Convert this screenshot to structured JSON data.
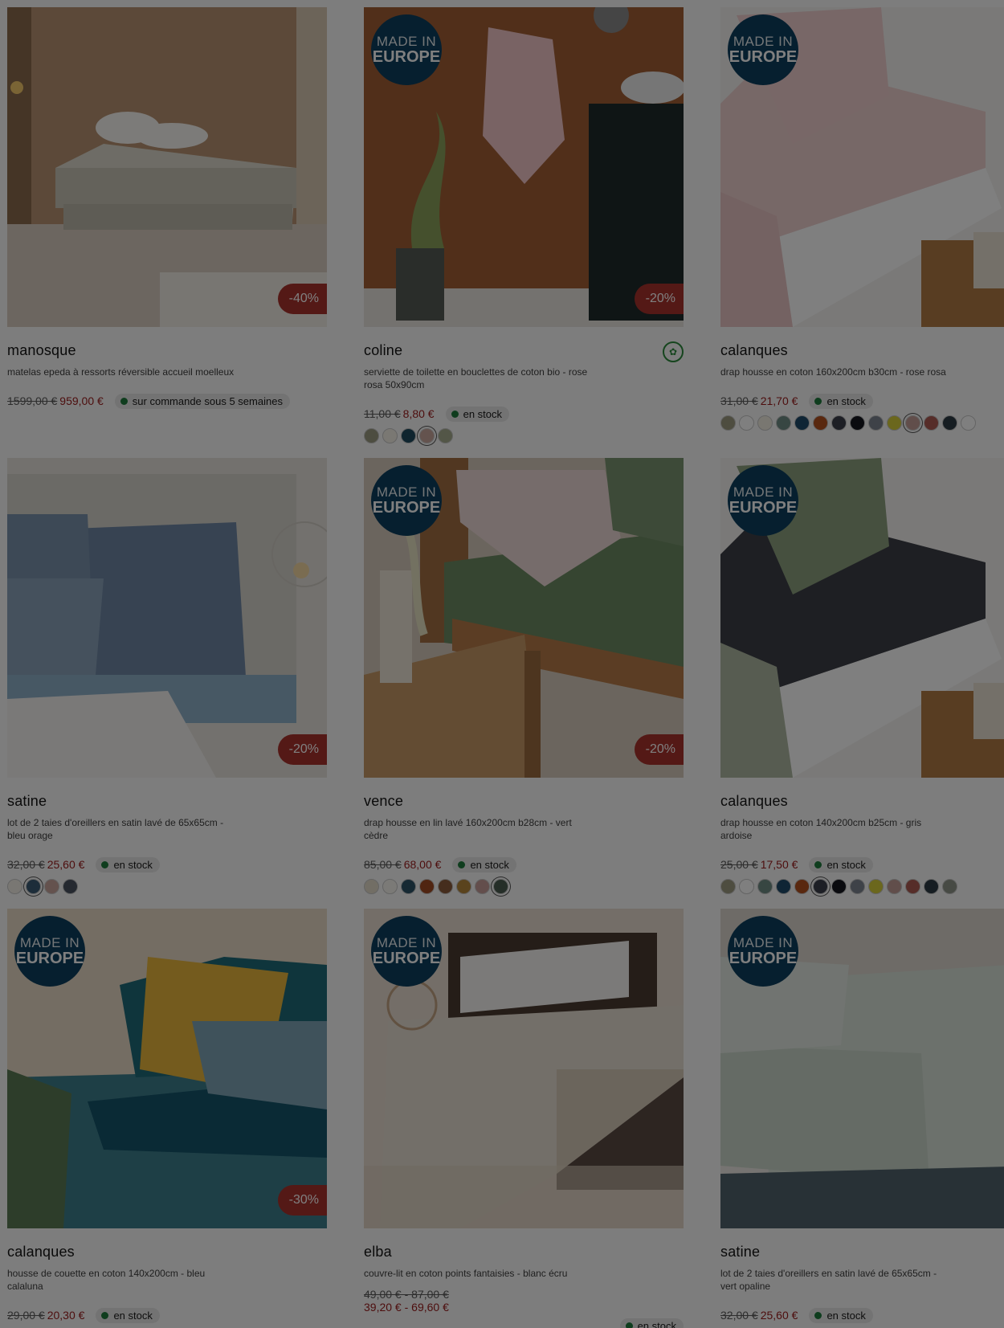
{
  "badges": {
    "made_in_l1": "MADE IN",
    "made_in_l2": "EUROPE"
  },
  "products": [
    {
      "name": "manosque",
      "desc": "matelas epeda à ressorts réversible accueil moelleux",
      "old_price": "1599,00 €",
      "new_price": "959,00 €",
      "discount": "-40%",
      "stock": "sur commande sous 5 semaines",
      "made_in_europe": false,
      "swatches": []
    },
    {
      "name": "coline",
      "desc": "serviette de toilette en bouclettes de coton bio - rose rosa 50x90cm",
      "old_price": "11,00 €",
      "new_price": "8,80 €",
      "discount": "-20%",
      "stock": "en stock",
      "made_in_europe": true,
      "eco_icon": "organic-cotton-icon",
      "swatches": [
        "#9b9b80",
        "#f4f0e6",
        "#1f4a5e",
        "#c9a69c",
        "#a6ad8f"
      ],
      "selected_swatch": 3
    },
    {
      "name": "calanques",
      "desc": "drap housse en coton 160x200cm b30cm - rose rosa",
      "old_price": "31,00 €",
      "new_price": "21,70 €",
      "discount": "",
      "stock": "en stock",
      "made_in_europe": true,
      "swatches": [
        "#9d9a80",
        "#ffffff",
        "#f3efe2",
        "#6e8c85",
        "#1e4a6b",
        "#b3501f",
        "#3a3e4a",
        "#14171f",
        "#7d8590",
        "#d6ce3a",
        "#c39d97",
        "#ad5a52",
        "#2d3b45",
        "#ffffff"
      ],
      "selected_swatch": 10
    },
    {
      "name": "satine",
      "desc": "lot de 2 taies d'oreillers en satin lavé de 65x65cm - bleu orage",
      "old_price": "32,00 €",
      "new_price": "25,60 €",
      "discount": "-20%",
      "stock": "en stock",
      "made_in_europe": false,
      "swatches": [
        "#f2efe6",
        "#3a5a74",
        "#c9a49c",
        "#4a5360"
      ],
      "selected_swatch": 1
    },
    {
      "name": "vence",
      "desc": "drap housse en lin lavé 160x200cm b28cm - vert cèdre",
      "old_price": "85,00 €",
      "new_price": "68,00 €",
      "discount": "-20%",
      "stock": "en stock",
      "made_in_europe": true,
      "swatches": [
        "#e4ddcb",
        "#f7f5ee",
        "#2c5266",
        "#a04a22",
        "#8a5a3a",
        "#b5873a",
        "#c69d98",
        "#4b5c50"
      ],
      "selected_swatch": 7
    },
    {
      "name": "calanques",
      "desc": "drap housse en coton 140x200cm b25cm - gris ardoise",
      "old_price": "25,00 €",
      "new_price": "17,50 €",
      "discount": "",
      "stock": "en stock",
      "made_in_europe": true,
      "swatches": [
        "#9d9a80",
        "#ffffff",
        "#6e8c85",
        "#1e4a6b",
        "#b3501f",
        "#3a3e4a",
        "#14171f",
        "#7d8590",
        "#d6ce3a",
        "#c39d97",
        "#ad5a52",
        "#2d3b45",
        "#8f9488"
      ],
      "selected_swatch": 5
    },
    {
      "name": "calanques",
      "desc": "housse de couette en coton 140x200cm - bleu calaluna",
      "old_price": "29,00 €",
      "new_price": "20,30 €",
      "discount": "-30%",
      "stock": "en stock",
      "made_in_europe": true,
      "swatches": []
    },
    {
      "name": "elba",
      "desc": "couvre-lit en coton points fantaisies - blanc écru",
      "old_price": "49,00 € - 87,00 €",
      "new_price": "39,20 € - 69,60 €",
      "discount": "",
      "stock": "en stock",
      "made_in_europe": true,
      "swatches": []
    },
    {
      "name": "satine",
      "desc": "lot de 2 taies d'oreillers en satin lavé de 65x65cm - vert opaline",
      "old_price": "32,00 €",
      "new_price": "25,60 €",
      "discount": "",
      "stock": "en stock",
      "made_in_europe": true,
      "swatches": []
    }
  ]
}
